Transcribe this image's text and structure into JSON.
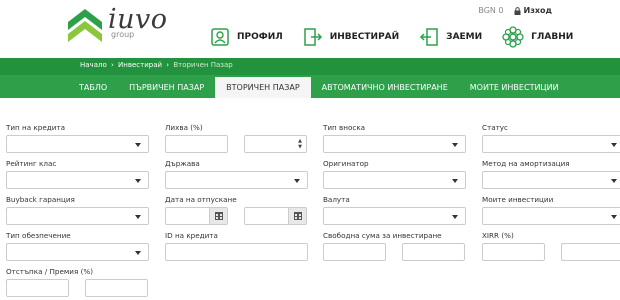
{
  "brand": {
    "name": "iuvo",
    "sub": "group"
  },
  "topbar": {
    "balance": "BGN 0",
    "logout": "Изход"
  },
  "mainnav": [
    {
      "label": "ПРОФИЛ",
      "icon": "profile-icon"
    },
    {
      "label": "ИНВЕСТИРАЙ",
      "icon": "invest-icon"
    },
    {
      "label": "ЗАЕМИ",
      "icon": "loans-icon"
    },
    {
      "label": "ГЛАВНИ",
      "icon": "main-icon"
    }
  ],
  "breadcrumb": {
    "home": "Начало",
    "sep": "›",
    "invest": "Инвестирай",
    "current": "Вторичен Пазар"
  },
  "tabs": [
    {
      "label": "ТАБЛО",
      "active": false
    },
    {
      "label": "ПЪРВИЧЕН ПАЗАР",
      "active": false
    },
    {
      "label": "ВТОРИЧЕН ПАЗАР",
      "active": true
    },
    {
      "label": "АВТОМАТИЧНО ИНВЕСТИРАНЕ",
      "active": false
    },
    {
      "label": "МОИТЕ ИНВЕСТИЦИИ",
      "active": false
    }
  ],
  "filters": {
    "loan_type": {
      "label": "Тип на кредита",
      "value": ""
    },
    "interest": {
      "label": "Лихва (%)",
      "from": "",
      "to": ""
    },
    "payment_type": {
      "label": "Тип вноска",
      "value": ""
    },
    "status": {
      "label": "Статус",
      "value": ""
    },
    "rating": {
      "label": "Рейтинг клас",
      "value": ""
    },
    "country": {
      "label": "Държава",
      "value": ""
    },
    "originator": {
      "label": "Оригинатор",
      "value": ""
    },
    "amortization": {
      "label": "Метод на амортизация",
      "value": ""
    },
    "buyback": {
      "label": "Buyback гаранция",
      "value": ""
    },
    "issue_date": {
      "label": "Дата на отпускане",
      "from": "",
      "to": ""
    },
    "currency": {
      "label": "Валута",
      "value": ""
    },
    "my_investments": {
      "label": "Моите инвестиции",
      "value": ""
    },
    "collateral": {
      "label": "Тип обезпечение",
      "value": ""
    },
    "loan_id": {
      "label": "ID на кредита",
      "value": ""
    },
    "free_amount": {
      "label": "Свободна сума за инвестиране",
      "from": "",
      "to": ""
    },
    "xirr": {
      "label": "XIRR (%)",
      "from": "",
      "to": ""
    },
    "discount": {
      "label": "Отстъпка / Премия (%)",
      "from": "",
      "to": ""
    }
  },
  "colors": {
    "brand_green": "#2ea04a",
    "dark_green": "#23923f"
  }
}
